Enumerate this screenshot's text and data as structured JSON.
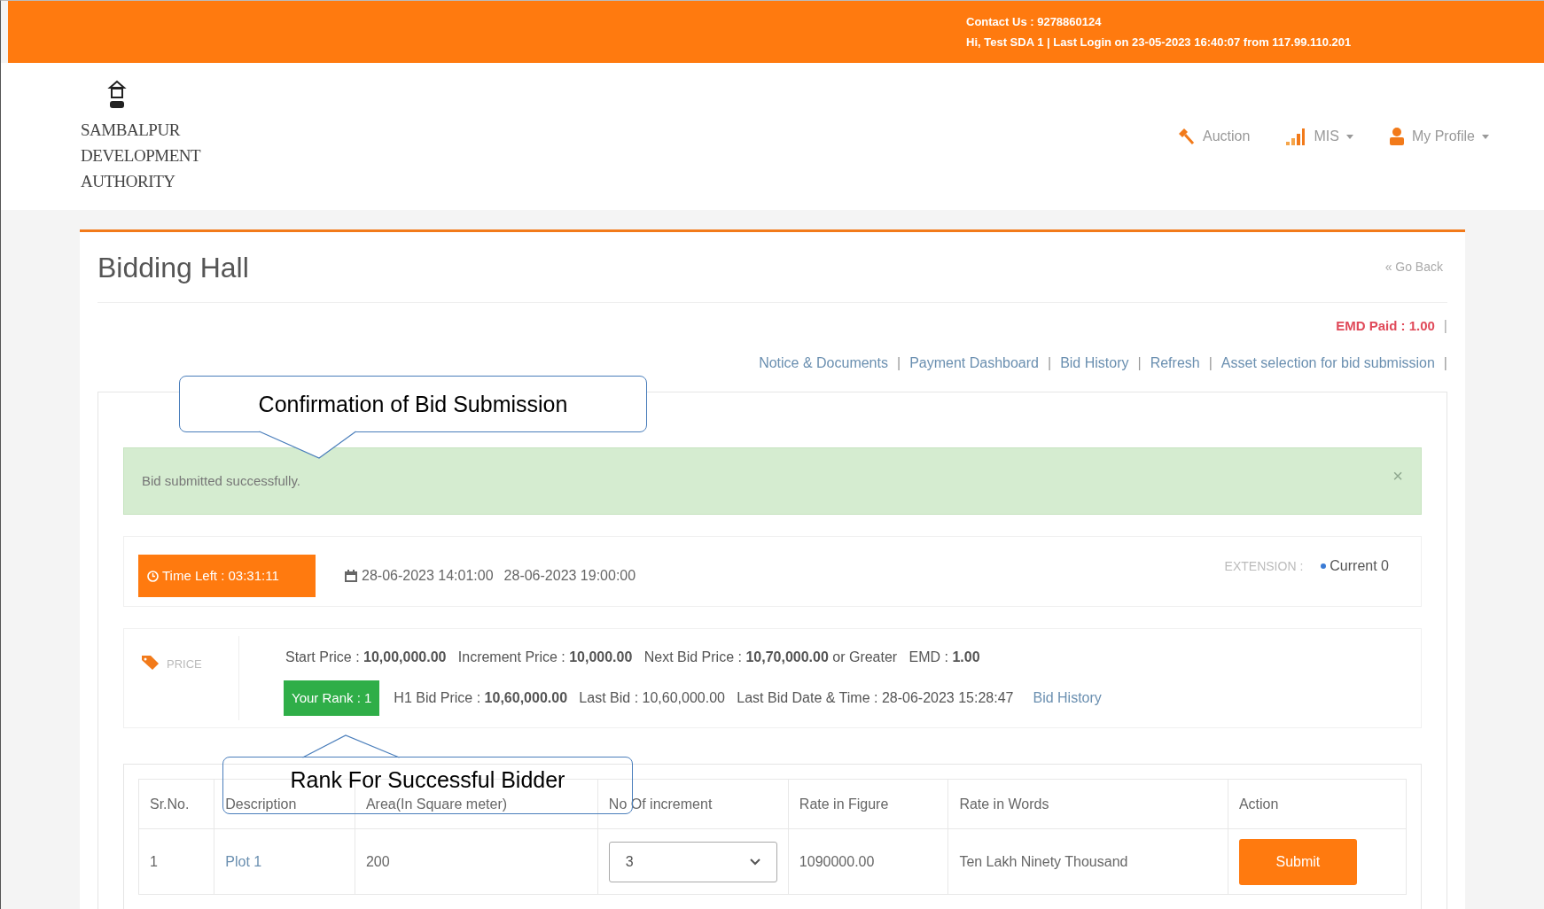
{
  "top_bar": {
    "contact": "Contact Us : 9278860124",
    "login_info": "Hi, Test SDA 1 | Last Login on 23-05-2023 16:40:07 from 117.99.110.201"
  },
  "logo": {
    "lines": [
      "SAMBALPUR",
      "DEVELOPMENT",
      "AUTHORITY"
    ]
  },
  "nav": [
    {
      "label": "Auction",
      "dropdown": false
    },
    {
      "label": "MIS",
      "dropdown": true
    },
    {
      "label": "My Profile",
      "dropdown": true
    }
  ],
  "page": {
    "title": "Bidding Hall",
    "back_link": "« Go Back",
    "emd_paid": "EMD Paid : 1.00",
    "emd_separator": "|"
  },
  "links": {
    "separator": "|",
    "items": [
      "Notice & Documents",
      "Payment Dashboard",
      "Bid History",
      "Refresh",
      "Asset selection for bid submission"
    ]
  },
  "alert": {
    "message": "Bid submitted successfully.",
    "close": "×"
  },
  "timer": {
    "time_left": "Time Left : 03:31:11",
    "start": "28-06-2023 14:01:00",
    "end": "28-06-2023 19:00:00",
    "extension_label": "EXTENSION :",
    "extension_value": "Current 0"
  },
  "price": {
    "label": "PRICE",
    "line1": "Start Price : **10,00,000.00**   Increment Price : **10,000.00**   Next Bid Price : **10,70,000.00** or Greater   EMD : **1.00**",
    "rank": "Your Rank : 1",
    "line2": "H1 Bid Price : **10,60,000.00**   Last Bid : 10,60,000.00   Last Bid Date & Time : 28-06-2023 15:28:47",
    "bid_history_link": "Bid History"
  },
  "table": {
    "columns": [
      "Sr.No.",
      "Description",
      "Area(In Square meter)",
      "No Of increment",
      "Rate in Figure",
      "Rate in Words",
      "Action"
    ],
    "rows": [
      {
        "sr": "1",
        "description": "Plot 1",
        "area": "200",
        "increment": "3",
        "rate_figure": "1090000.00",
        "rate_words": "Ten Lakh Ninety Thousand",
        "action": "Submit"
      }
    ]
  },
  "callouts": [
    {
      "text": "Confirmation of Bid Submission",
      "kind": "below"
    },
    {
      "text": "Rank For Successful Bidder",
      "kind": "above"
    }
  ]
}
